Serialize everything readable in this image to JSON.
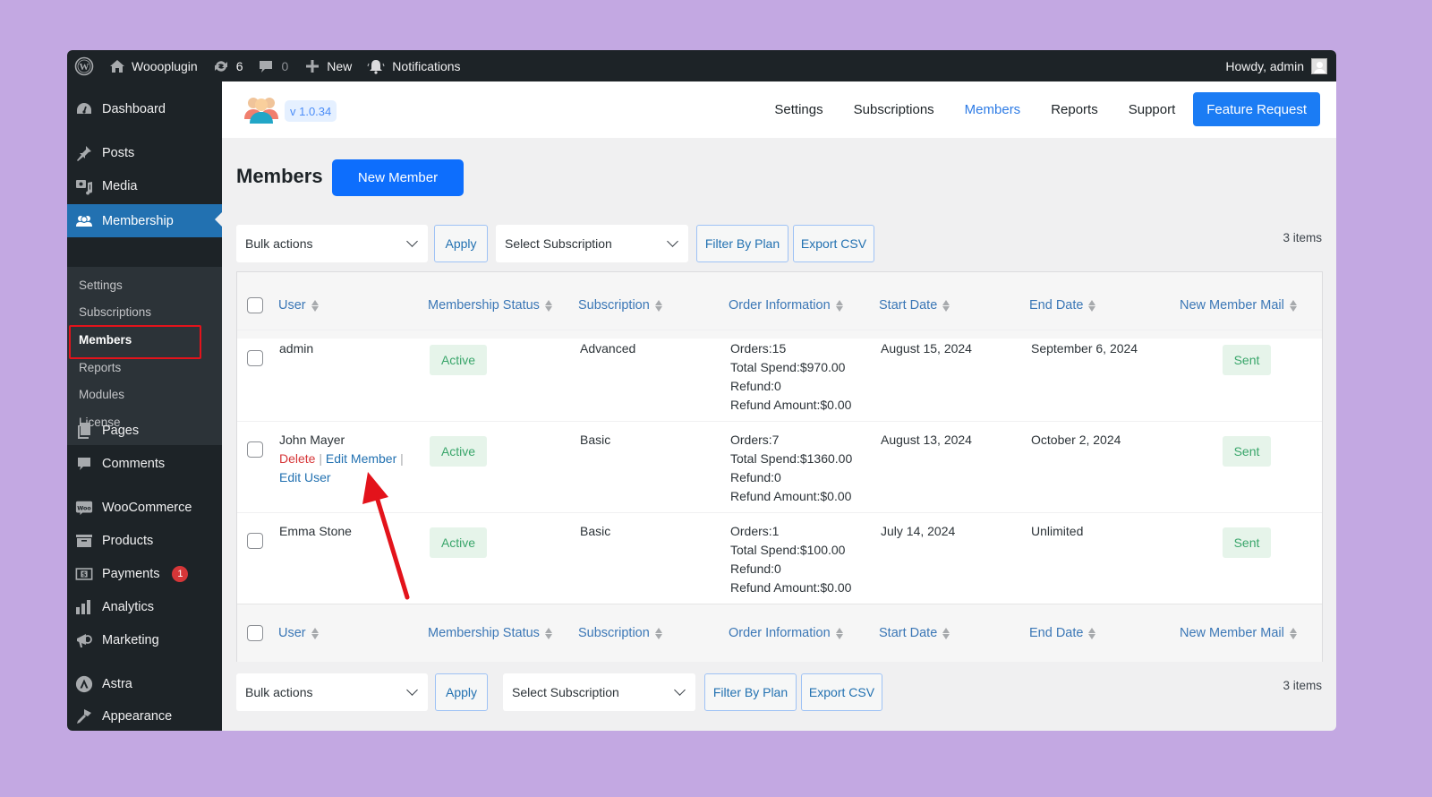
{
  "admin_bar": {
    "site_name": "Woooplugin",
    "updates_count": "6",
    "comments_count": "0",
    "new_label": "New",
    "notifications_label": "Notifications",
    "greeting": "Howdy, admin"
  },
  "sidebar": {
    "items": [
      {
        "label": "Dashboard",
        "icon": "dashboard-icon"
      },
      {
        "label": "Posts",
        "icon": "pin-icon"
      },
      {
        "label": "Media",
        "icon": "media-icon"
      },
      {
        "label": "Membership",
        "icon": "users-icon",
        "active": true
      },
      {
        "label": "Pages",
        "icon": "pages-icon"
      },
      {
        "label": "Comments",
        "icon": "comment-icon"
      },
      {
        "label": "WooCommerce",
        "icon": "woo-icon"
      },
      {
        "label": "Products",
        "icon": "archive-icon"
      },
      {
        "label": "Payments",
        "icon": "dollar-icon",
        "badge": "1"
      },
      {
        "label": "Analytics",
        "icon": "bar-chart-icon"
      },
      {
        "label": "Marketing",
        "icon": "megaphone-icon"
      },
      {
        "label": "Astra",
        "icon": "astra-icon"
      },
      {
        "label": "Appearance",
        "icon": "brush-icon"
      }
    ],
    "submenu": [
      {
        "label": "Settings"
      },
      {
        "label": "Subscriptions"
      },
      {
        "label": "Members",
        "current": true
      },
      {
        "label": "Reports"
      },
      {
        "label": "Modules"
      },
      {
        "label": "License"
      }
    ]
  },
  "plugin_header": {
    "version": "v 1.0.34",
    "nav": [
      {
        "label": "Settings"
      },
      {
        "label": "Subscriptions"
      },
      {
        "label": "Members",
        "active": true
      },
      {
        "label": "Reports"
      },
      {
        "label": "Support"
      }
    ],
    "feature_request": "Feature Request"
  },
  "page": {
    "title": "Members",
    "new_member_button": "New Member"
  },
  "toolbar_top": {
    "bulk_actions": "Bulk actions",
    "apply": "Apply",
    "subscription_select": "Select Subscription",
    "filter_by_plan": "Filter By Plan",
    "export_csv": "Export CSV",
    "items_count": "3 items"
  },
  "toolbar_bottom": {
    "bulk_actions": "Bulk actions",
    "apply": "Apply",
    "subscription_select": "Select Subscription",
    "filter_by_plan": "Filter By Plan",
    "export_csv": "Export CSV",
    "items_count": "3 items"
  },
  "table": {
    "columns": [
      "User",
      "Membership Status",
      "Subscription",
      "Order Information",
      "Start Date",
      "End Date",
      "New Member Mail"
    ],
    "rows": [
      {
        "user": "admin",
        "status": "Active",
        "subscription": "Advanced",
        "orders": "Orders:15",
        "total_spend": "Total Spend:$970.00",
        "refund": "Refund:0",
        "refund_amount": "Refund Amount:$0.00",
        "start_date": "August 15, 2024",
        "end_date": "September 6, 2024",
        "mail": "Sent"
      },
      {
        "user": "John Mayer",
        "status": "Active",
        "subscription": "Basic",
        "orders": "Orders:7",
        "total_spend": "Total Spend:$1360.00",
        "refund": "Refund:0",
        "refund_amount": "Refund Amount:$0.00",
        "start_date": "August 13, 2024",
        "end_date": "October 2, 2024",
        "mail": "Sent",
        "actions": {
          "delete": "Delete",
          "edit_member": "Edit Member",
          "edit_user": "Edit User",
          "separator": "|"
        }
      },
      {
        "user": "Emma Stone",
        "status": "Active",
        "subscription": "Basic",
        "orders": "Orders:1",
        "total_spend": "Total Spend:$100.00",
        "refund": "Refund:0",
        "refund_amount": "Refund Amount:$0.00",
        "start_date": "July 14, 2024",
        "end_date": "Unlimited",
        "mail": "Sent"
      }
    ]
  },
  "colors": {
    "background": "#c3a8e2",
    "admin_bar": "#1d2327",
    "wp_blue": "#2271b1",
    "plugin_blue": "#1b7cf4",
    "active_green": "#3aa66b",
    "annotation_red": "#e3131b"
  }
}
